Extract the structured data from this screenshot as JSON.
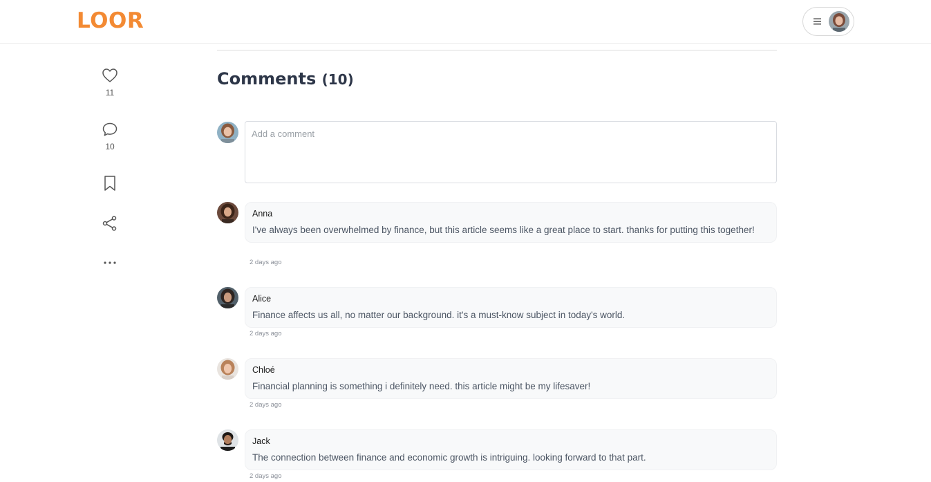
{
  "header": {
    "logo": "LOOR",
    "menu_icon": "hamburger-icon",
    "user_avatar": "user-avatar"
  },
  "sidebar": {
    "like": {
      "icon": "heart-icon",
      "count": "11"
    },
    "comment": {
      "icon": "comment-bubble-icon",
      "count": "10"
    },
    "bookmark": {
      "icon": "bookmark-icon"
    },
    "share": {
      "icon": "share-icon"
    },
    "more": {
      "icon": "more-dots-icon"
    }
  },
  "comments": {
    "title": "Comments",
    "count": "(10)",
    "compose_placeholder": "Add a comment",
    "items": [
      {
        "author": "Anna",
        "text": "I've always been overwhelmed by finance, but this article seems like a great place to start. thanks for putting this together!",
        "time": "2 days ago"
      },
      {
        "author": "Alice",
        "text": "Finance affects us all, no matter our background. it's a must-know subject in today's world.",
        "time": "2 days ago"
      },
      {
        "author": "Chloé",
        "text": "Financial planning is something i definitely need. this article might be my lifesaver!",
        "time": "2 days ago"
      },
      {
        "author": "Jack",
        "text": "The connection between finance and economic growth is intriguing. looking forward to that part.",
        "time": "2 days ago"
      }
    ]
  },
  "colors": {
    "brand": "#f38a33",
    "title": "#2d3648",
    "bubble": "#f8f9fa"
  }
}
